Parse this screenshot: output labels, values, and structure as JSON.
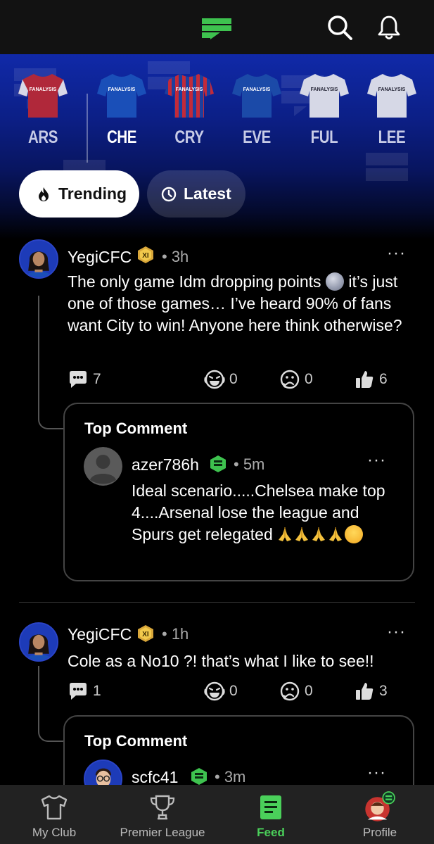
{
  "app": {
    "brand_color": "#4ad05a",
    "background": "#000000"
  },
  "header": {
    "logo_icon": "fanalysis-flag-icon",
    "search_icon": "search-icon",
    "bell_icon": "bell-icon"
  },
  "clubs": [
    {
      "code": "ARS",
      "kit_text": "FANALYSIS",
      "primary": "#b0283a",
      "sleeve": "#d8d8e8",
      "selected": false
    },
    {
      "code": "CHE",
      "kit_text": "FANALYSIS",
      "primary": "#1a4fb8",
      "sleeve": "#1a4fb8",
      "selected": true
    },
    {
      "code": "CRY",
      "kit_text": "FANALYSIS",
      "primary": "#1d3f9e",
      "sleeve": "#c22a3a",
      "selected": false
    },
    {
      "code": "EVE",
      "kit_text": "FANALYSIS",
      "primary": "#1b4aa8",
      "sleeve": "#1b4aa8",
      "selected": false
    },
    {
      "code": "FUL",
      "kit_text": "FANALYSIS",
      "primary": "#d6d8e6",
      "sleeve": "#d6d8e6",
      "selected": false
    },
    {
      "code": "LEE",
      "kit_text": "FANALYSIS",
      "primary": "#d6d8e6",
      "sleeve": "#d6d8e6",
      "selected": false
    }
  ],
  "tabs": {
    "trending": "Trending",
    "latest": "Latest",
    "active": "trending"
  },
  "posts": [
    {
      "username": "YegiCFC",
      "badge": "XI",
      "time": "• 3h",
      "body_before_emoji": "The only game Idm dropping points ",
      "body_after_emoji": " it’s just one of those games… I’ve heard 90% of fans want City to win! Anyone here think otherwise?",
      "comments": "7",
      "laughs": "0",
      "sad": "0",
      "likes": "6",
      "top_comment": {
        "title": "Top Comment",
        "username": "azer786h",
        "time": "• 5m",
        "body": "Ideal scenario.....Chelsea make top 4....Arsenal lose the league and Spurs get relegated "
      }
    },
    {
      "username": "YegiCFC",
      "badge": "XI",
      "time": "• 1h",
      "body": "Cole as a No10 ?! that’s what I like to see!!",
      "comments": "1",
      "laughs": "0",
      "sad": "0",
      "likes": "3",
      "top_comment": {
        "title": "Top Comment",
        "username": "scfc41",
        "time": "• 3m"
      }
    }
  ],
  "more_label": "···",
  "nav": [
    {
      "label": "My Club",
      "icon": "shirt-icon"
    },
    {
      "label": "Premier League",
      "icon": "trophy-icon"
    },
    {
      "label": "Feed",
      "icon": "feed-icon",
      "active": true
    },
    {
      "label": "Profile",
      "icon": "profile-avatar-icon"
    }
  ]
}
